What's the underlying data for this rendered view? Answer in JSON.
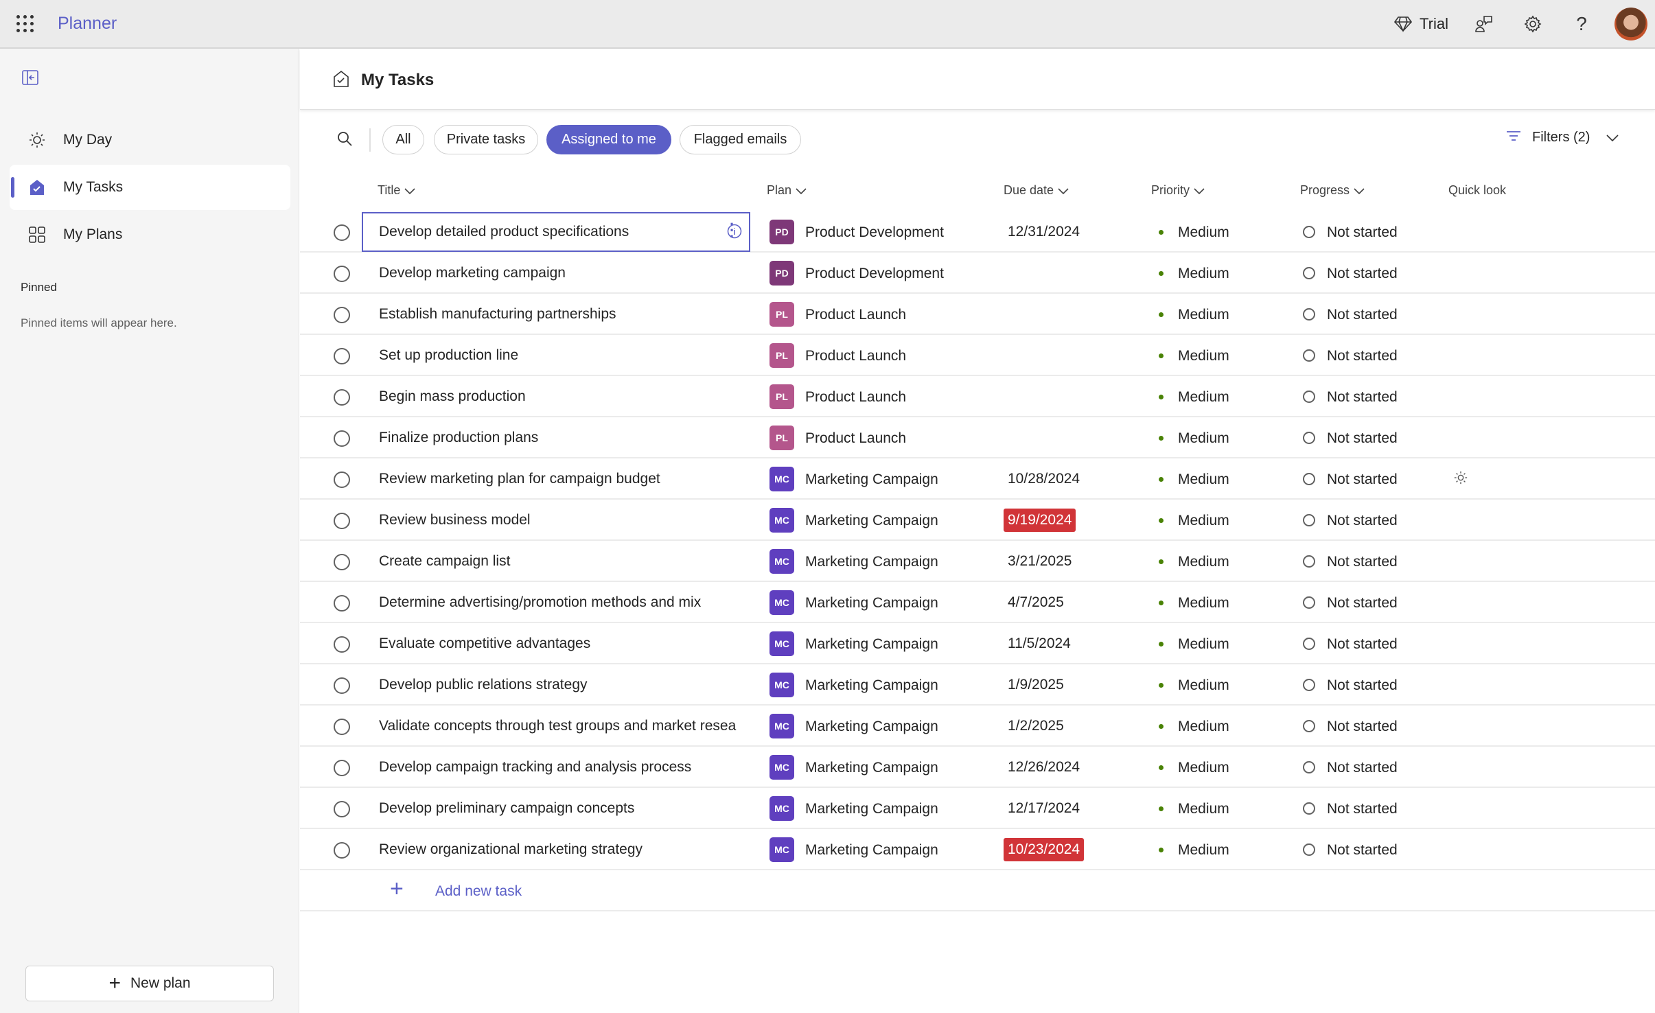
{
  "app": {
    "name": "Planner",
    "trial_label": "Trial"
  },
  "colors": {
    "accent": "#5b5fc7",
    "overdue": "#d13438",
    "priority_medium": "#498205",
    "PD": "#7e3878",
    "PL": "#b4568c",
    "MC": "#5f3fbf"
  },
  "sidebar": {
    "items": [
      {
        "label": "My Day",
        "icon": "sun-icon"
      },
      {
        "label": "My Tasks",
        "icon": "tasks-icon",
        "selected": true
      },
      {
        "label": "My Plans",
        "icon": "grid-icon"
      }
    ],
    "pinned_heading": "Pinned",
    "pinned_empty": "Pinned items will appear here.",
    "new_plan": "New plan"
  },
  "page": {
    "title": "My Tasks"
  },
  "filters": {
    "pills": [
      "All",
      "Private tasks",
      "Assigned to me",
      "Flagged emails"
    ],
    "active": "Assigned to me",
    "filters_label": "Filters (2)"
  },
  "columns": {
    "title": "Title",
    "plan": "Plan",
    "due": "Due date",
    "priority": "Priority",
    "progress": "Progress",
    "quick_look": "Quick look"
  },
  "tasks": [
    {
      "title": "Develop detailed product specifications",
      "plan_abbr": "PD",
      "plan": "Product Development",
      "due": "12/31/2024",
      "overdue": false,
      "priority": "Medium",
      "progress": "Not started",
      "selected": true
    },
    {
      "title": "Develop marketing campaign",
      "plan_abbr": "PD",
      "plan": "Product Development",
      "due": "",
      "overdue": false,
      "priority": "Medium",
      "progress": "Not started"
    },
    {
      "title": "Establish manufacturing partnerships",
      "plan_abbr": "PL",
      "plan": "Product Launch",
      "due": "",
      "overdue": false,
      "priority": "Medium",
      "progress": "Not started"
    },
    {
      "title": "Set up production line",
      "plan_abbr": "PL",
      "plan": "Product Launch",
      "due": "",
      "overdue": false,
      "priority": "Medium",
      "progress": "Not started"
    },
    {
      "title": "Begin mass production",
      "plan_abbr": "PL",
      "plan": "Product Launch",
      "due": "",
      "overdue": false,
      "priority": "Medium",
      "progress": "Not started"
    },
    {
      "title": "Finalize production plans",
      "plan_abbr": "PL",
      "plan": "Product Launch",
      "due": "",
      "overdue": false,
      "priority": "Medium",
      "progress": "Not started"
    },
    {
      "title": "Review marketing plan for campaign budget",
      "plan_abbr": "MC",
      "plan": "Marketing Campaign",
      "due": "10/28/2024",
      "overdue": false,
      "priority": "Medium",
      "progress": "Not started",
      "quick_look": "sun-icon"
    },
    {
      "title": "Review business model",
      "plan_abbr": "MC",
      "plan": "Marketing Campaign",
      "due": "9/19/2024",
      "overdue": true,
      "priority": "Medium",
      "progress": "Not started"
    },
    {
      "title": "Create campaign list",
      "plan_abbr": "MC",
      "plan": "Marketing Campaign",
      "due": "3/21/2025",
      "overdue": false,
      "priority": "Medium",
      "progress": "Not started"
    },
    {
      "title": "Determine advertising/promotion methods and mix",
      "plan_abbr": "MC",
      "plan": "Marketing Campaign",
      "due": "4/7/2025",
      "overdue": false,
      "priority": "Medium",
      "progress": "Not started"
    },
    {
      "title": "Evaluate competitive advantages",
      "plan_abbr": "MC",
      "plan": "Marketing Campaign",
      "due": "11/5/2024",
      "overdue": false,
      "priority": "Medium",
      "progress": "Not started"
    },
    {
      "title": "Develop public relations strategy",
      "plan_abbr": "MC",
      "plan": "Marketing Campaign",
      "due": "1/9/2025",
      "overdue": false,
      "priority": "Medium",
      "progress": "Not started"
    },
    {
      "title": "Validate concepts through test groups and market resea",
      "plan_abbr": "MC",
      "plan": "Marketing Campaign",
      "due": "1/2/2025",
      "overdue": false,
      "priority": "Medium",
      "progress": "Not started"
    },
    {
      "title": "Develop campaign tracking and analysis process",
      "plan_abbr": "MC",
      "plan": "Marketing Campaign",
      "due": "12/26/2024",
      "overdue": false,
      "priority": "Medium",
      "progress": "Not started"
    },
    {
      "title": "Develop preliminary campaign concepts",
      "plan_abbr": "MC",
      "plan": "Marketing Campaign",
      "due": "12/17/2024",
      "overdue": false,
      "priority": "Medium",
      "progress": "Not started"
    },
    {
      "title": "Review organizational marketing strategy",
      "plan_abbr": "MC",
      "plan": "Marketing Campaign",
      "due": "10/23/2024",
      "overdue": true,
      "priority": "Medium",
      "progress": "Not started"
    }
  ],
  "add_task": "Add new task"
}
